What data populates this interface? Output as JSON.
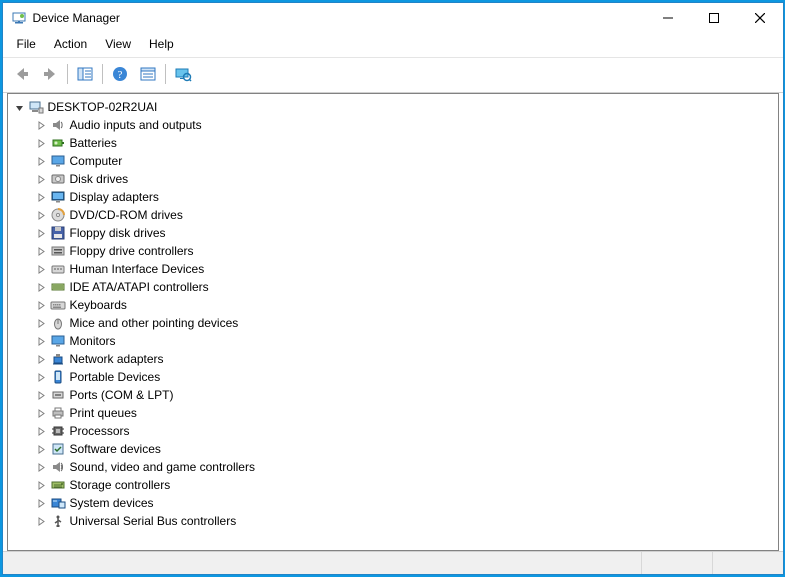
{
  "window": {
    "title": "Device Manager"
  },
  "menu": {
    "file": "File",
    "action": "Action",
    "view": "View",
    "help": "Help"
  },
  "toolbar": {
    "back": "Back",
    "forward": "Forward",
    "show_hide": "Show/Hide Console Tree",
    "help": "Help",
    "properties": "Properties",
    "scan": "Scan for hardware changes"
  },
  "tree": {
    "root": {
      "label": "DESKTOP-02R2UAI",
      "icon": "computer"
    },
    "children": [
      {
        "label": "Audio inputs and outputs",
        "icon": "audio"
      },
      {
        "label": "Batteries",
        "icon": "battery"
      },
      {
        "label": "Computer",
        "icon": "monitor"
      },
      {
        "label": "Disk drives",
        "icon": "disk"
      },
      {
        "label": "Display adapters",
        "icon": "display"
      },
      {
        "label": "DVD/CD-ROM drives",
        "icon": "cdrom"
      },
      {
        "label": "Floppy disk drives",
        "icon": "floppy"
      },
      {
        "label": "Floppy drive controllers",
        "icon": "floppyctrl"
      },
      {
        "label": "Human Interface Devices",
        "icon": "hid"
      },
      {
        "label": "IDE ATA/ATAPI controllers",
        "icon": "ide"
      },
      {
        "label": "Keyboards",
        "icon": "keyboard"
      },
      {
        "label": "Mice and other pointing devices",
        "icon": "mouse"
      },
      {
        "label": "Monitors",
        "icon": "monitor"
      },
      {
        "label": "Network adapters",
        "icon": "network"
      },
      {
        "label": "Portable Devices",
        "icon": "portable"
      },
      {
        "label": "Ports (COM & LPT)",
        "icon": "port"
      },
      {
        "label": "Print queues",
        "icon": "printer"
      },
      {
        "label": "Processors",
        "icon": "cpu"
      },
      {
        "label": "Software devices",
        "icon": "software"
      },
      {
        "label": "Sound, video and game controllers",
        "icon": "sound"
      },
      {
        "label": "Storage controllers",
        "icon": "storage"
      },
      {
        "label": "System devices",
        "icon": "system"
      },
      {
        "label": "Universal Serial Bus controllers",
        "icon": "usb"
      }
    ]
  }
}
